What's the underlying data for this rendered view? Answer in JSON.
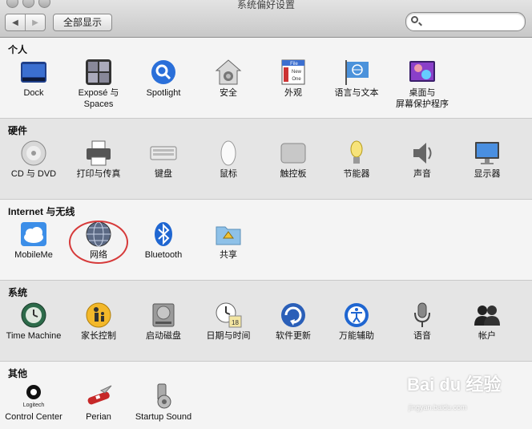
{
  "window": {
    "title": "系统偏好设置"
  },
  "toolbar": {
    "back": "◀",
    "forward": "▶",
    "show_all": "全部显示",
    "search_value": ""
  },
  "sections": [
    {
      "title": "个人",
      "panes": [
        "Dock",
        "Exposé 与\nSpaces",
        "Spotlight",
        "安全",
        "外观",
        "语言与文本",
        "桌面与\n屏幕保护程序"
      ]
    },
    {
      "title": "硬件",
      "panes": [
        "CD 与 DVD",
        "打印与传真",
        "键盘",
        "鼠标",
        "触控板",
        "节能器",
        "声音",
        "显示器"
      ]
    },
    {
      "title": "Internet 与无线",
      "panes": [
        "MobileMe",
        "网络",
        "Bluetooth",
        "共享"
      ]
    },
    {
      "title": "系统",
      "panes": [
        "Time Machine",
        "家长控制",
        "启动磁盘",
        "日期与时间",
        "软件更新",
        "万能辅助",
        "语音",
        "帐户"
      ]
    },
    {
      "title": "其他",
      "panes": [
        "Control Center",
        "Perian",
        "Startup Sound"
      ]
    }
  ],
  "icon_text": {
    "logitech": "Logitech",
    "file": "File",
    "new": "New",
    "one": "One",
    "date": "18"
  },
  "watermark": {
    "brand": "Bai du 经验",
    "url": "jingyan.baidu.com"
  },
  "colors": {
    "highlight_ring": "#d63a3a"
  }
}
